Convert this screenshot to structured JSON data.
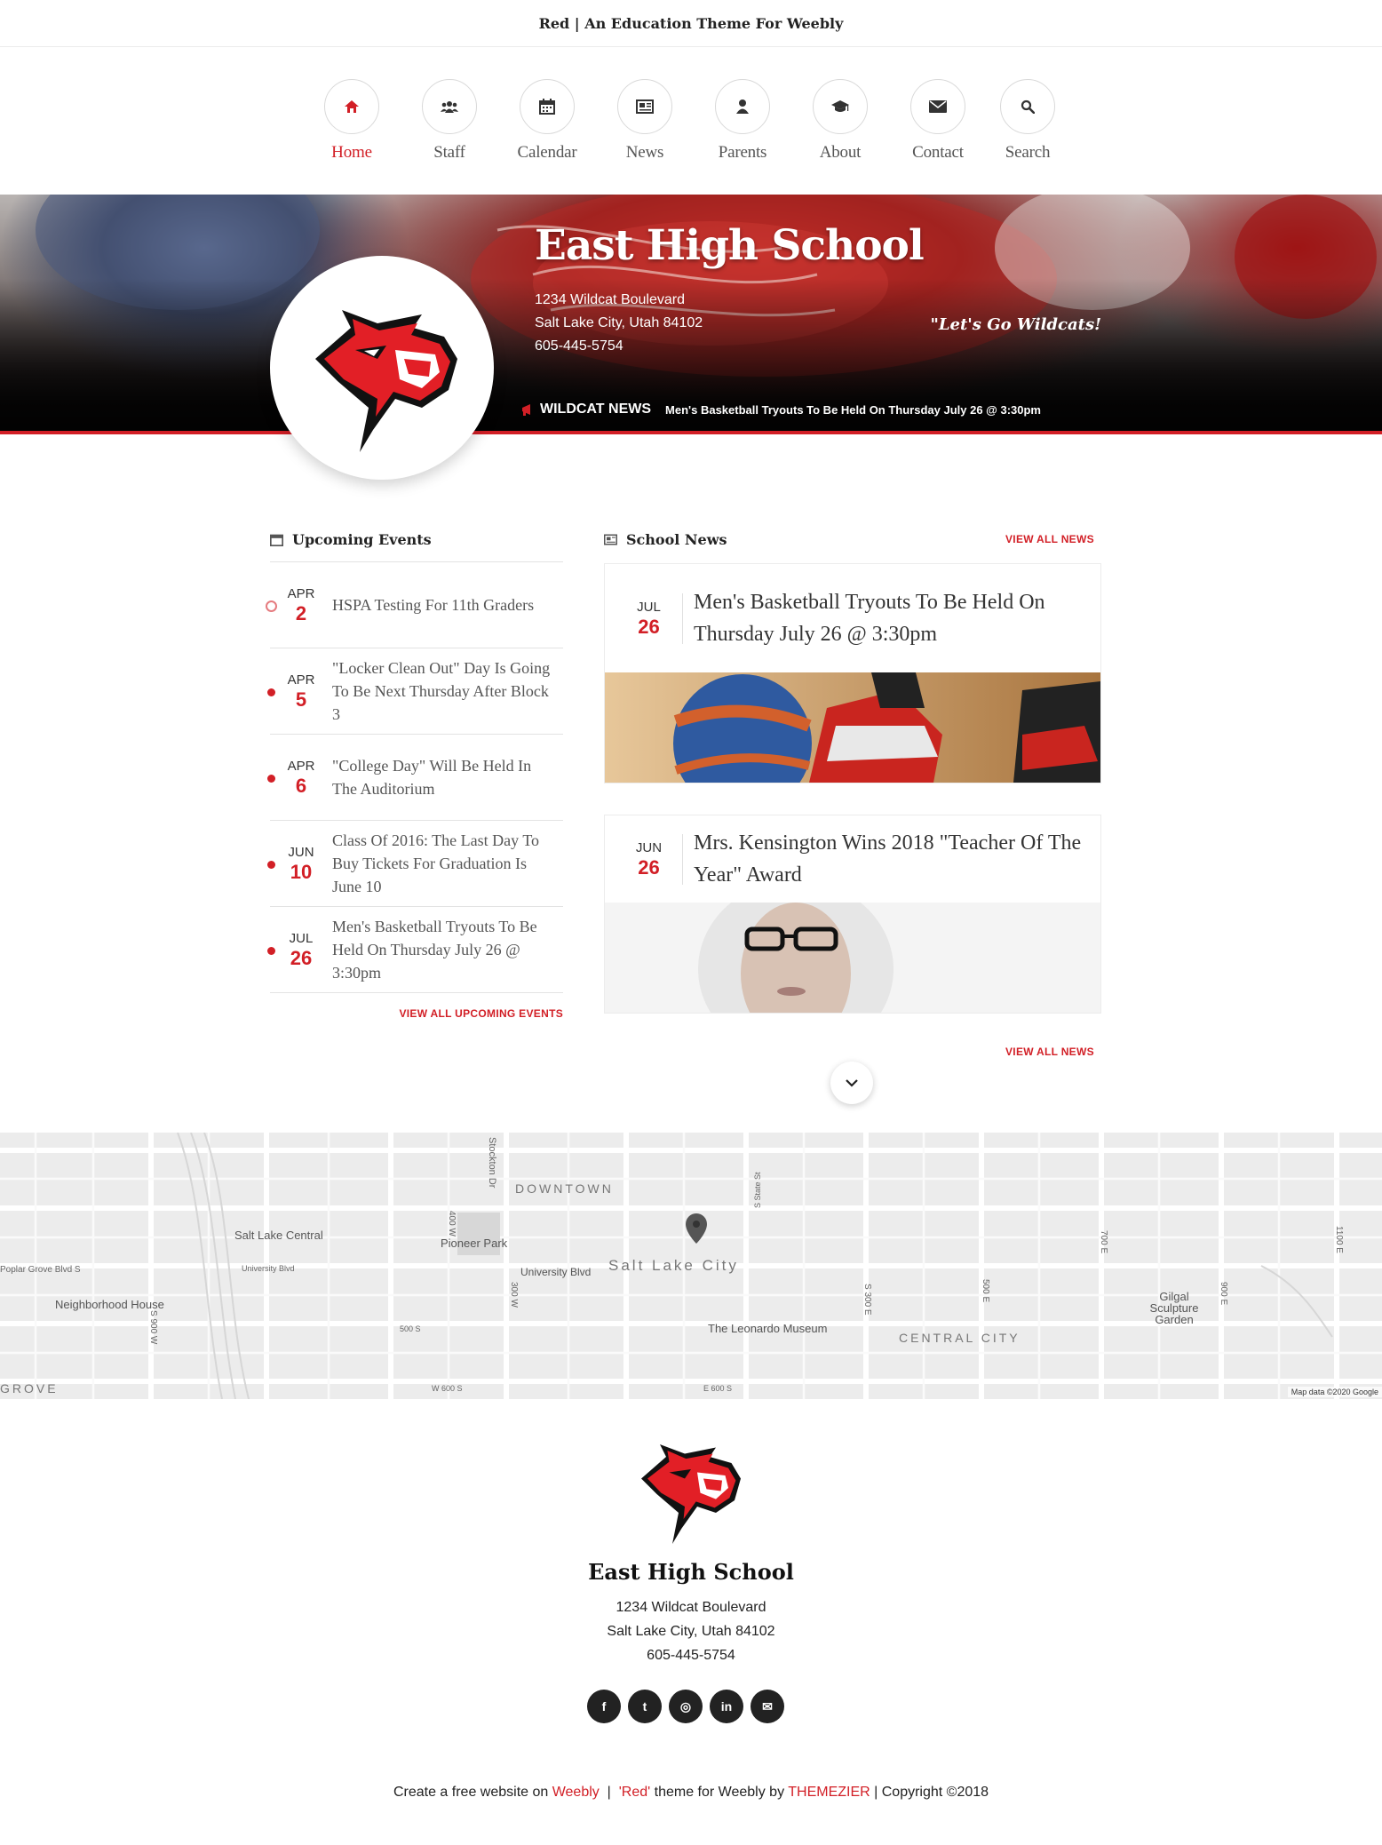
{
  "top_bar": {
    "title": "Red | An Education Theme For Weebly"
  },
  "nav": {
    "items": [
      {
        "label": "Home",
        "icon": "home-icon",
        "active": true
      },
      {
        "label": "Staff",
        "icon": "users-icon"
      },
      {
        "label": "Calendar",
        "icon": "calendar-icon"
      },
      {
        "label": "News",
        "icon": "newspaper-icon"
      },
      {
        "label": "Parents",
        "icon": "user-icon"
      },
      {
        "label": "About",
        "icon": "graduation-cap-icon"
      },
      {
        "label": "Contact",
        "icon": "envelope-icon"
      },
      {
        "label": "Search",
        "icon": "search-icon"
      }
    ]
  },
  "hero": {
    "school_name": "East High School",
    "address_line1": "1234 Wildcat Boulevard",
    "address_line2": "Salt Lake City, Utah 84102",
    "phone": "605-445-5754",
    "slogan": "\"Let's Go Wildcats!",
    "ticker_label": "WILDCAT NEWS",
    "ticker_text": "Men's Basketball Tryouts To Be Held On Thursday July 26 @ 3:30pm"
  },
  "events": {
    "title": "Upcoming Events",
    "items": [
      {
        "month": "APR",
        "day": "2",
        "title": "HSPA Testing For 11th Graders"
      },
      {
        "month": "APR",
        "day": "5",
        "title": "\"Locker Clean Out\" Day Is Going To Be Next Thursday After Block 3"
      },
      {
        "month": "APR",
        "day": "6",
        "title": "\"College Day\" Will Be Held In The Auditorium"
      },
      {
        "month": "JUN",
        "day": "10",
        "title": "Class Of 2016: The Last Day To Buy Tickets For Graduation Is June 10"
      },
      {
        "month": "JUL",
        "day": "26",
        "title": "Men's Basketball Tryouts To Be Held On Thursday July 26 @ 3:30pm"
      }
    ],
    "view_all": "VIEW ALL UPCOMING EVENTS"
  },
  "news": {
    "title": "School News",
    "view_all_top": "VIEW ALL NEWS",
    "view_all_bottom": "VIEW ALL NEWS",
    "items": [
      {
        "month": "JUL",
        "day": "26",
        "title": "Men's Basketball Tryouts To Be Held On Thursday July 26 @ 3:30pm"
      },
      {
        "month": "JUN",
        "day": "26",
        "title": "Mrs. Kensington Wins 2018 \"Teacher Of The Year\" Award"
      }
    ]
  },
  "map": {
    "labels": {
      "downtown": "DOWNTOWN",
      "slc": "Salt Lake City",
      "central": "CENTRAL CITY",
      "grove": "GROVE",
      "pioneer": "Pioneer Park",
      "slc_central": "Salt Lake Central",
      "neighborhood": "Neighborhood House",
      "leonardo": "The Leonardo Museum",
      "gilgal": "Gilgal Sculpture Garden",
      "univ1": "University Blvd",
      "univ2": "University Blvd",
      "poplar": "Poplar Grove Blvd S",
      "stockton": "Stockton Dr",
      "s400w": "400 W",
      "s300w": "300 W",
      "state": "S State St",
      "s300e": "S 300 E",
      "s500e": "500 E",
      "s700e": "700 E",
      "s900e": "900 E",
      "s1100e": "1100 E",
      "s900w": "S 900 W",
      "w600s": "W 600 S",
      "e600s": "E 600 S",
      "s500s": "500 S"
    },
    "credit": "Map data ©2020 Google"
  },
  "footer": {
    "school_name": "East High School",
    "address_line1": "1234 Wildcat Boulevard",
    "address_line2": "Salt Lake City, Utah 84102",
    "phone": "605-445-5754",
    "socials": [
      {
        "name": "facebook",
        "glyph": "f"
      },
      {
        "name": "twitter",
        "glyph": "t"
      },
      {
        "name": "instagram",
        "glyph": "◎"
      },
      {
        "name": "linkedin",
        "glyph": "in"
      },
      {
        "name": "email",
        "glyph": "✉"
      }
    ],
    "credit_prefix": "Create a free website on ",
    "credit_weebly": "Weebly",
    "credit_sep": "  |  ",
    "credit_red": "'Red'",
    "credit_mid": " theme for Weebly by ",
    "credit_themezier": "THEMEZIER",
    "credit_suffix": " | Copyright ©2018"
  },
  "colors": {
    "accent": "#d21f26",
    "dark": "#222222"
  }
}
